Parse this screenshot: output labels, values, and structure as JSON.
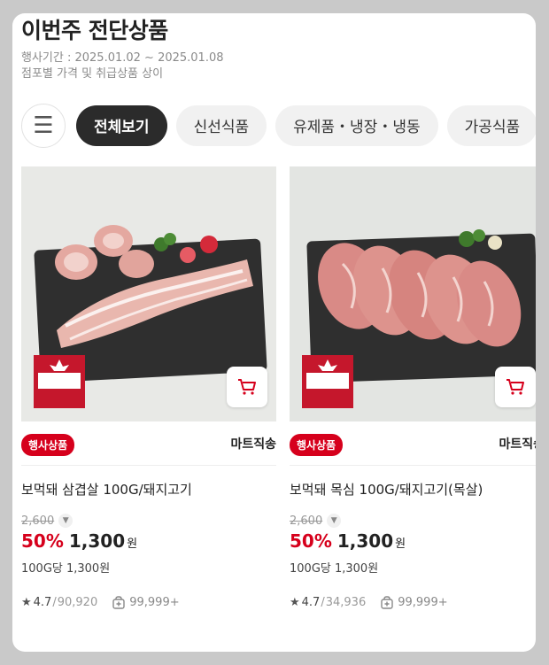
{
  "header": {
    "title": "이번주 전단상품",
    "period": "행사기간 : 2025.01.02 ~ 2025.01.08",
    "note": "점포별 가격 및 취급상품 상이"
  },
  "tabs": [
    {
      "label": "전체보기",
      "active": true
    },
    {
      "label": "신선식품",
      "active": false
    },
    {
      "label": "유제품・냉장・냉동",
      "active": false
    },
    {
      "label": "가공식품",
      "active": false
    }
  ],
  "icons": {
    "menu": "hamburger-menu-icon",
    "cart": "cart-icon",
    "star": "star-icon",
    "pick": "pick-bag-icon"
  },
  "colors": {
    "accent": "#d6001c",
    "active_tab": "#2b2b2b"
  },
  "products": [
    {
      "badge": "행사상품",
      "shipping": "마트직송",
      "name": "보먹돼 삼겹살 100G/돼지고기",
      "original_price": "2,600",
      "discount": "50%",
      "price": "1,300",
      "currency": "원",
      "unit_price": "100G당 1,300원",
      "rating": "4.7",
      "review_count": "90,920",
      "pick_count": "99,999+"
    },
    {
      "badge": "행사상품",
      "shipping": "마트직송",
      "name": "보먹돼 목심 100G/돼지고기(목살)",
      "original_price": "2,600",
      "discount": "50%",
      "price": "1,300",
      "currency": "원",
      "unit_price": "100G당 1,300원",
      "rating": "4.7",
      "review_count": "34,936",
      "pick_count": "99,999+"
    }
  ]
}
